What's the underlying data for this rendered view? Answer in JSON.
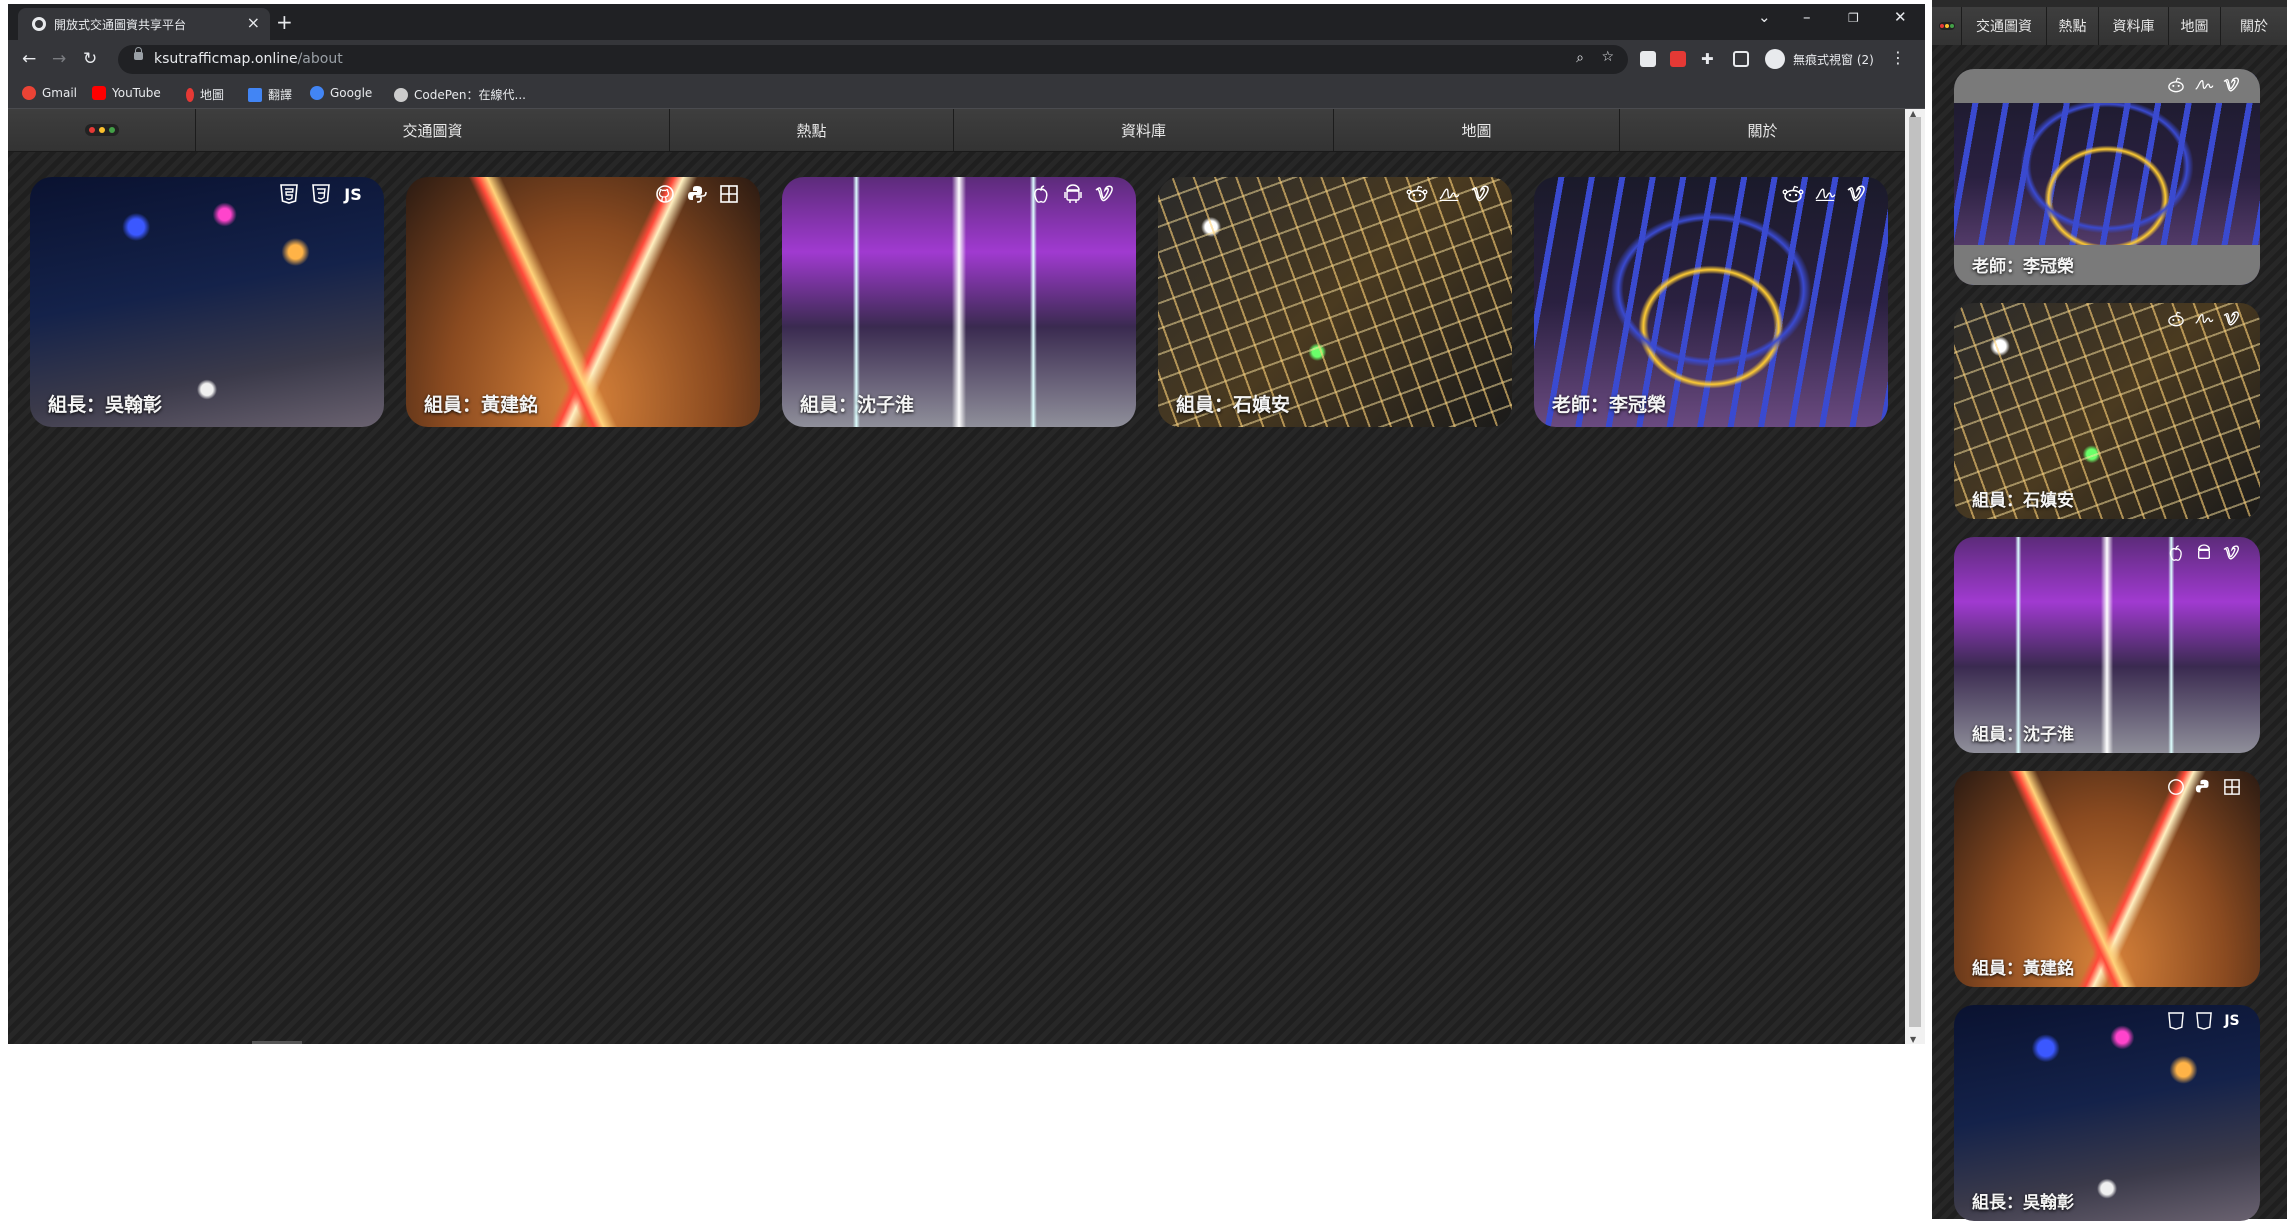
{
  "browser": {
    "tab_title": "開放式交通圖資共享平台",
    "new_tab": "+",
    "url_host": "ksutrafficmap.online",
    "url_path": "/about",
    "profile_label": "無痕式視窗 (2)",
    "bookmarks": [
      {
        "label": "Gmail",
        "color": "#ea4335"
      },
      {
        "label": "YouTube",
        "color": "#ff0000"
      },
      {
        "label": "地圖",
        "color": "#e53935"
      },
      {
        "label": "翻譯",
        "color": "#4285f4"
      },
      {
        "label": "Google",
        "color": "#4285f4"
      },
      {
        "label": "CodePen：在線代...",
        "color": "#cccccc"
      }
    ]
  },
  "nav": {
    "items": [
      "交通圖資",
      "熱點",
      "資料庫",
      "地圖",
      "關於"
    ]
  },
  "cards": [
    {
      "label": "組長：吳翰彰",
      "icons": [
        "html5-icon",
        "css3-icon",
        "js-icon"
      ]
    },
    {
      "label": "組員：黃建銘",
      "icons": [
        "github-icon",
        "python-icon",
        "windows-icon"
      ]
    },
    {
      "label": "組員：沈子淮",
      "icons": [
        "apple-icon",
        "android-icon",
        "vimeo-icon"
      ]
    },
    {
      "label": "組員：石嫃安",
      "icons": [
        "reddit-icon",
        "signature-icon",
        "vimeo-icon"
      ]
    },
    {
      "label": "老師：李冠榮",
      "icons": [
        "reddit-icon",
        "signature-icon",
        "vimeo-icon"
      ]
    }
  ],
  "mobile": {
    "nav_items": [
      "交通圖資",
      "熱點",
      "資料庫",
      "地圖",
      "關於"
    ],
    "cards": [
      {
        "label": "老師：李冠榮"
      },
      {
        "label": "組員：石嫃安"
      },
      {
        "label": "組員：沈子淮"
      },
      {
        "label": "組員：黃建銘"
      },
      {
        "label": "組長：吳翰彰"
      }
    ]
  },
  "icon_glyphs": {
    "js": "JS"
  }
}
